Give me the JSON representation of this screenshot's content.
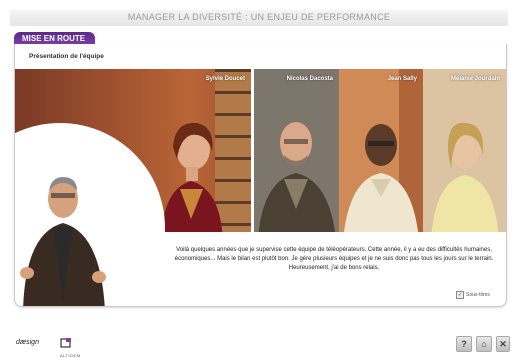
{
  "header": {
    "title": "MANAGER LA DIVERSITÉ : UN ENJEU DE PERFORMANCE"
  },
  "tab": {
    "label": "MISE EN ROUTE"
  },
  "section": {
    "title": "Présentation de l'équipe"
  },
  "team": [
    {
      "name": "Sylvie Doucet"
    },
    {
      "name": "Nicolas Dacosta"
    },
    {
      "name": "Jean Sally"
    },
    {
      "name": "Mélanie Jourdain"
    }
  ],
  "transcript": "Voilà quelques années que je supervise cette équipe de téléopérateurs. Cette année, il y a eu des difficultés humaines, économiques... Mais le bilan est plutôt bon. Je gère plusieurs équipes et je ne suis donc pas tous les jours sur le terrain. Heureusement, j'ai de bons relais.",
  "subtitles": {
    "label": "Sous-titres",
    "checked": true,
    "check_mark": "✓"
  },
  "footer": {
    "logo_left": "dæsign",
    "logo_right": "ALTIDEM"
  },
  "buttons": {
    "help": "?",
    "home": "⌂",
    "close": "✕"
  },
  "colors": {
    "accent": "#6a3399"
  }
}
